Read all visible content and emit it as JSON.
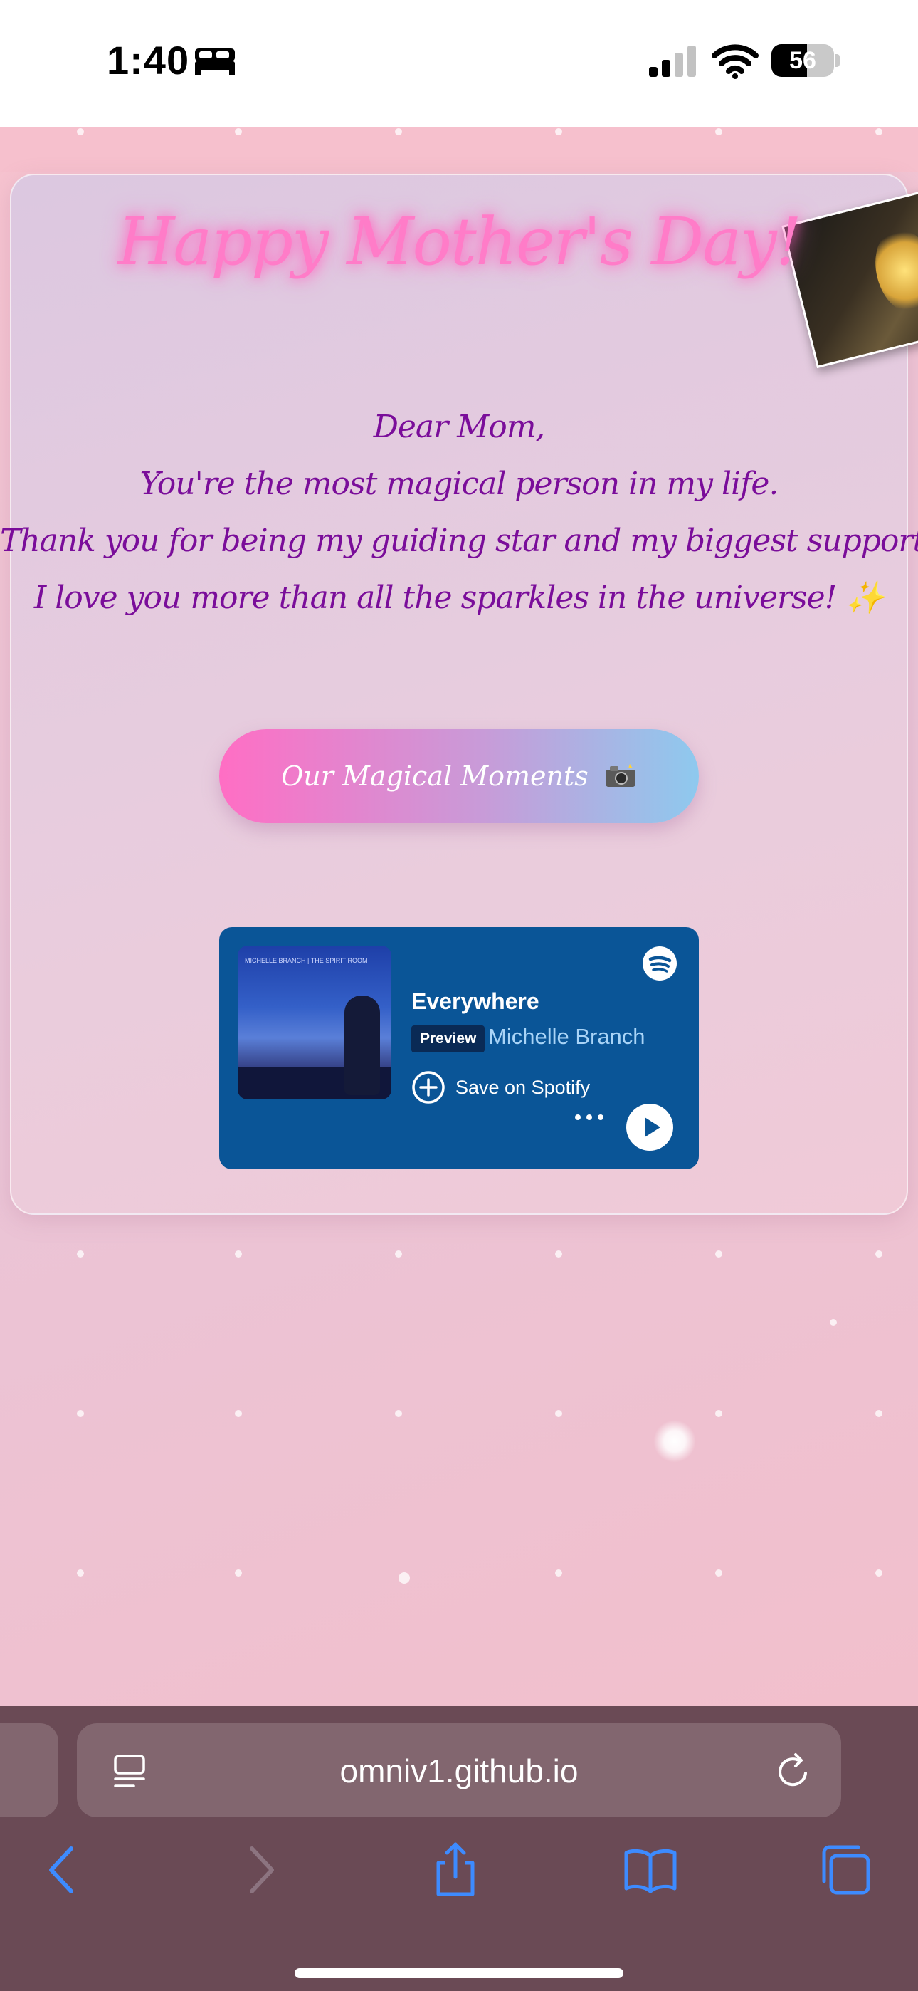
{
  "status_bar": {
    "time": "1:40",
    "battery": "56",
    "icons": [
      "bed-icon",
      "cellular-signal-icon",
      "wifi-icon",
      "battery-icon"
    ]
  },
  "page": {
    "headline": "Happy Mother's Day!",
    "letter_lines": [
      "Dear Mom,",
      "You're the most magical person in my life.",
      "Thank you for being my guiding star and my biggest supporter.",
      "I love you more than all the sparkles in the universe! ✨"
    ],
    "moments_button": "Our Magical Moments",
    "moments_button_emoji_icon": "camera-flash-icon",
    "colors": {
      "headline_glow": "#ff7cc8",
      "letter_text": "#7a0d9a",
      "button_gradient_start": "#ff6ec4",
      "button_gradient_end": "#8ec9ee"
    }
  },
  "spotify": {
    "track_title": "Everywhere",
    "preview_label": "Preview",
    "artist": "Michelle Branch",
    "save_label": "Save on Spotify",
    "album_caption": "MICHELLE BRANCH | THE SPIRIT ROOM",
    "background_color": "#0a5597"
  },
  "browser": {
    "url": "omniv1.github.io",
    "nav_icons": [
      "back-icon",
      "forward-icon",
      "share-icon",
      "bookmarks-icon",
      "tabs-icon"
    ]
  }
}
